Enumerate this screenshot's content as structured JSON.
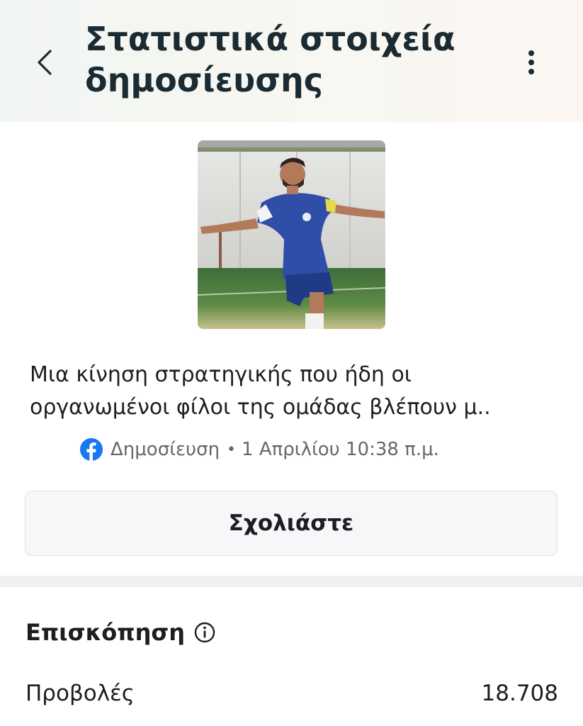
{
  "header": {
    "title": "Στατιστικά στοιχεία δημοσίευσης",
    "back_icon": "chevron-left-icon",
    "more_icon": "more-vertical-icon"
  },
  "post": {
    "caption_line1": "Μια κίνηση στρατηγικής που ήδη οι",
    "caption_line2": "οργανωμένοι φίλοι της ομάδας βλέπουν μ..",
    "platform_icon": "facebook-icon",
    "type_label": "Δημοσίευση",
    "separator": "•",
    "date": "1 Απριλίου 10:38 π.μ.",
    "brand_color": "#1877F2"
  },
  "actions": {
    "comment_label": "Σχολιάστε"
  },
  "overview": {
    "title": "Επισκόπηση",
    "info_icon": "info-icon",
    "stats": [
      {
        "label": "Προβολές",
        "value": "18.708"
      }
    ]
  }
}
